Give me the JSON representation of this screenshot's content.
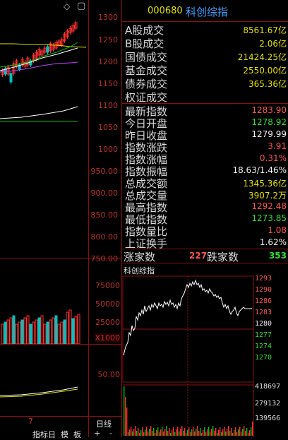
{
  "header": {
    "code": "000680",
    "name": "科创综指"
  },
  "toolbar": {
    "diamond_icon": "◇",
    "window_icon": "▢"
  },
  "price_axis": [
    "1300",
    "1250",
    "1200",
    "1150",
    "1100",
    "1050",
    "1000",
    "950.00",
    "900.00",
    "850.00",
    "800.00",
    "750.00"
  ],
  "volume_axis": [
    "75000",
    "50000",
    "25000",
    "X1000"
  ],
  "indicator_axis": [
    "50.00"
  ],
  "quote_rows": [
    {
      "label": "A股成交",
      "value": "8561.67亿",
      "color": "yel"
    },
    {
      "label": "B股成交",
      "value": "2.06亿",
      "color": "yel"
    },
    {
      "label": "国债成交",
      "value": "21424.25亿",
      "color": "yel"
    },
    {
      "label": "基金成交",
      "value": "2550.00亿",
      "color": "yel"
    },
    {
      "label": "债券成交",
      "value": "365.36亿",
      "color": "yel"
    },
    {
      "label": "权证成交",
      "value": "",
      "color": "yel"
    }
  ],
  "index_rows": [
    {
      "label": "最新指数",
      "value": "1283.90",
      "color": "red"
    },
    {
      "label": "今日开盘",
      "value": "1278.92",
      "color": "grn"
    },
    {
      "label": "昨日收盘",
      "value": "1279.99",
      "color": "wht"
    },
    {
      "label": "指数涨跌",
      "value": "3.91",
      "color": "red"
    },
    {
      "label": "指数涨幅",
      "value": "0.31%",
      "color": "red"
    },
    {
      "label": "指数振幅",
      "value": "18.63/1.46%",
      "color": "wht"
    },
    {
      "label": "总成交额",
      "value": "1345.36亿",
      "color": "yel"
    },
    {
      "label": "总成交量",
      "value": "3907.2万",
      "color": "yel"
    },
    {
      "label": "最高指数",
      "value": "1292.48",
      "color": "red"
    },
    {
      "label": "最低指数",
      "value": "1273.85",
      "color": "grn"
    },
    {
      "label": "指数量比",
      "value": "1.08",
      "color": "red"
    },
    {
      "label": "上证换手",
      "value": "1.62%",
      "color": "wht"
    }
  ],
  "breadth": {
    "up_label": "涨家数",
    "up_value": "227",
    "down_label": "跌家数",
    "down_value": "353"
  },
  "mini_chart": {
    "title": "科创综指",
    "price_labels": [
      {
        "text": "1293",
        "color": "red"
      },
      {
        "text": "1290",
        "color": "red"
      },
      {
        "text": "1286",
        "color": "red"
      },
      {
        "text": "1283",
        "color": "red"
      },
      {
        "text": "1280",
        "color": "wht"
      },
      {
        "text": "1277",
        "color": "grn"
      },
      {
        "text": "1274",
        "color": "grn"
      },
      {
        "text": "1270",
        "color": "grn"
      }
    ],
    "volume_labels": [
      "418697",
      "279132",
      "139566"
    ]
  },
  "bottom_tabs": {
    "tab1": "指标日",
    "tab2": "模",
    "tab3": "板",
    "period": "日线",
    "plus": "+",
    "minus": "-",
    "left_num": "7"
  },
  "colors": {
    "up": "#ff3030",
    "down": "#00c0c0",
    "grid": "#8a1010",
    "ma_yellow": "#e0e000",
    "ma_purple": "#c040ff",
    "ma_green": "#00c000",
    "ma_white": "#ffffff"
  }
}
